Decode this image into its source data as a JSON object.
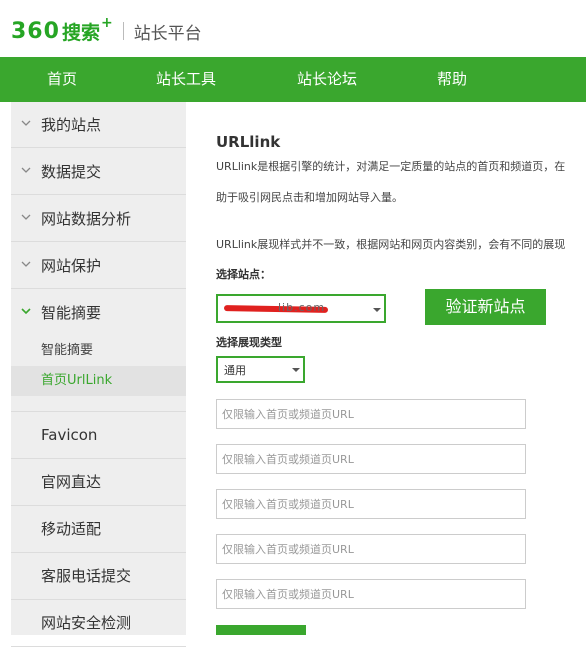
{
  "header": {
    "logo_360": "360",
    "logo_search": "搜索",
    "logo_plus": "+",
    "logo_sub": "站长平台"
  },
  "nav": {
    "items": [
      "首页",
      "站长工具",
      "站长论坛",
      "帮助"
    ]
  },
  "sidebar": {
    "collapsed": [
      "我的站点",
      "数据提交",
      "网站数据分析",
      "网站保护"
    ],
    "open_group": "智能摘要",
    "sub_items": [
      "智能摘要",
      "首页UrlLink"
    ],
    "plain_items": [
      "Favicon",
      "官网直达",
      "移动适配",
      "客服电话提交",
      "网站安全检测"
    ]
  },
  "main": {
    "title": "URLlink",
    "desc1": "URLlink是根据引擎的统计，对满足一定质量的站点的首页和频道页，在",
    "desc2": "助于吸引网民点击和增加网站导入量。",
    "desc3": "URLlink展现样式并不一致，根据网站和网页内容类别，会有不同的展现",
    "site_label": "选择站点：",
    "site_value_masked": "lib.com",
    "verify_button": "验证新站点",
    "type_label": "选择展现类型",
    "type_value": "通用",
    "url_placeholder": "仅限输入首页或频道页URL"
  },
  "colors": {
    "brand_green": "#3aa72e",
    "sidebar_bg": "#eeeeee",
    "mask_red": "#e0211f"
  }
}
